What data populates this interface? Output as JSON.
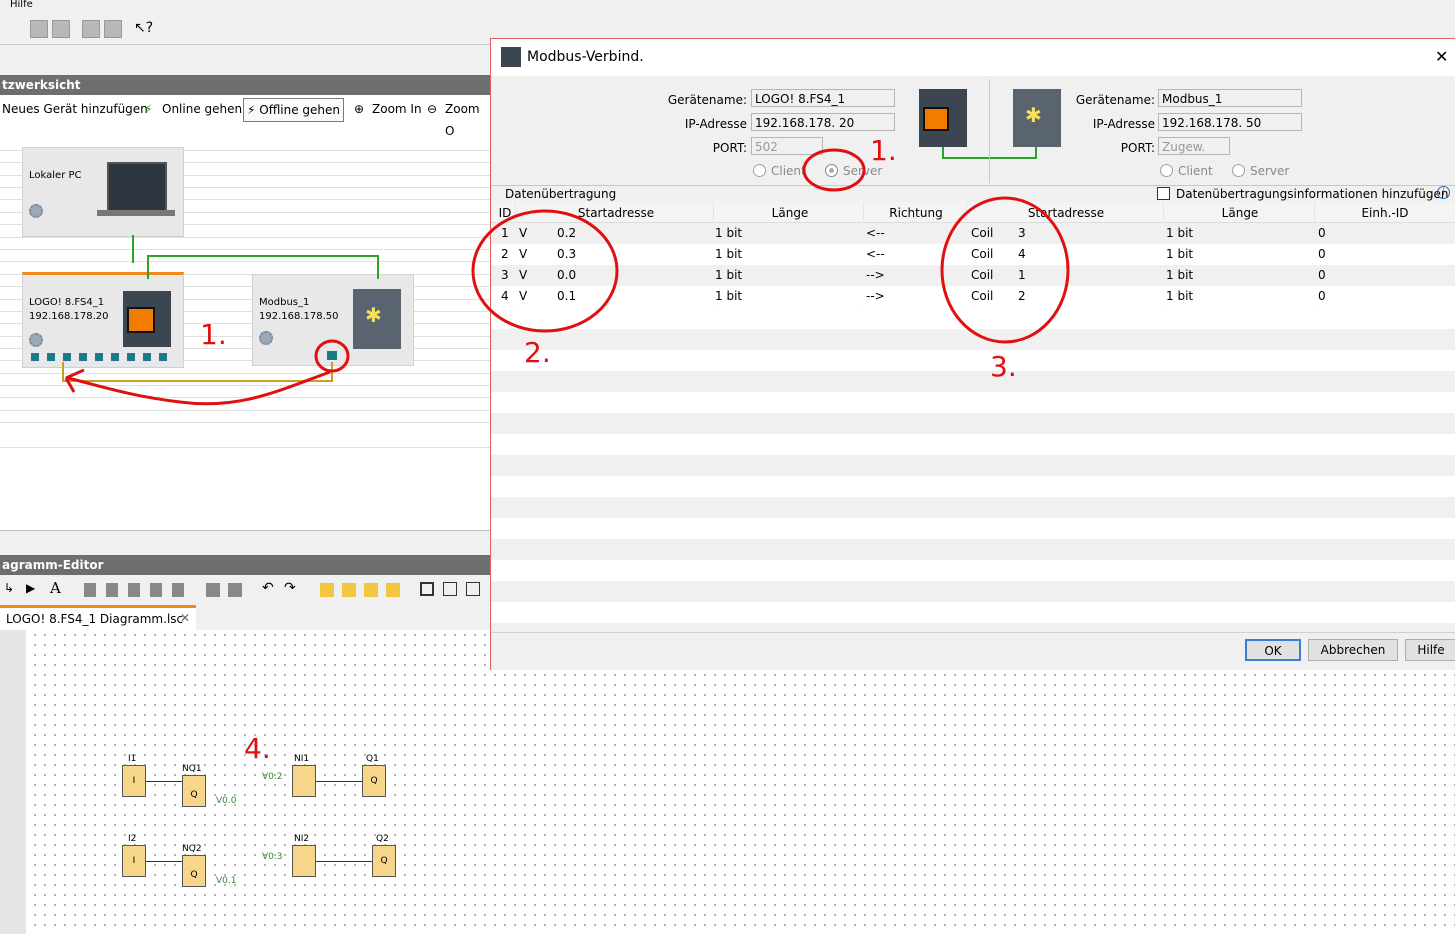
{
  "menu": {
    "help": "Hilfe"
  },
  "network_view": {
    "title": "tzwerksicht",
    "toolbar": {
      "add_device": "Neues Gerät hinzufügen",
      "online": "Online gehen",
      "offline": "Offline gehen",
      "zoom_in": "Zoom In",
      "zoom_out": "Zoom O"
    },
    "devices": {
      "pc": {
        "name": "Lokaler PC"
      },
      "logo": {
        "name": "LOGO! 8.FS4_1",
        "ip": "192.168.178.20"
      },
      "modbus": {
        "name": "Modbus_1",
        "ip": "192.168.178.50"
      }
    }
  },
  "diagram_editor": {
    "title": "agramm-Editor",
    "tab_label": "LOGO! 8.FS4_1 Diagramm.lsc",
    "toolbar_text_icon": "A"
  },
  "diagram": {
    "blocks": [
      {
        "top": "I1",
        "inner": "I"
      },
      {
        "top": "NQ1",
        "inner": "Q"
      },
      {
        "top": "NI1",
        "inner": ""
      },
      {
        "top": "Q1",
        "inner": "Q"
      },
      {
        "top": "I2",
        "inner": "I"
      },
      {
        "top": "NQ2",
        "inner": "Q"
      },
      {
        "top": "NI2",
        "inner": ""
      },
      {
        "top": "Q2",
        "inner": "Q"
      }
    ],
    "vlabels": [
      "V0.0",
      "V0.2",
      "V0.1",
      "V0.3"
    ]
  },
  "annotations": {
    "a1": "1.",
    "a1b": "1.",
    "a2": "2.",
    "a3": "3.",
    "a4": "4."
  },
  "dialog": {
    "title": "Modbus-Verbind.",
    "close": "✕",
    "left": {
      "device_name_label": "Gerätename:",
      "device_name": "LOGO! 8.FS4_1",
      "ip_label": "IP-Adresse",
      "ip": "192.168.178. 20",
      "port_label": "PORT:",
      "port": "502",
      "client": "Client",
      "server": "Server"
    },
    "right": {
      "device_name_label": "Gerätename:",
      "device_name": "Modbus_1",
      "ip_label": "IP-Adresse",
      "ip": "192.168.178. 50",
      "port_label": "PORT:",
      "port": "Zugew.",
      "client": "Client",
      "server": "Server"
    },
    "section_label": "Datenübertragung",
    "add_info_label": "Datenübertragungsinformationen hinzufügen",
    "info_icon": "i",
    "columns": [
      "ID",
      "Startadresse",
      "Länge",
      "Richtung",
      "Startadresse",
      "Länge",
      "Einh.-ID"
    ],
    "rows": [
      {
        "id": "1",
        "area": "V",
        "addr": "0.2",
        "len": "1 bit",
        "dir": "<--",
        "rarea": "Coil",
        "raddr": "3",
        "rlen": "1 bit",
        "unit": "0"
      },
      {
        "id": "2",
        "area": "V",
        "addr": "0.3",
        "len": "1 bit",
        "dir": "<--",
        "rarea": "Coil",
        "raddr": "4",
        "rlen": "1 bit",
        "unit": "0"
      },
      {
        "id": "3",
        "area": "V",
        "addr": "0.0",
        "len": "1 bit",
        "dir": "-->",
        "rarea": "Coil",
        "raddr": "1",
        "rlen": "1 bit",
        "unit": "0"
      },
      {
        "id": "4",
        "area": "V",
        "addr": "0.1",
        "len": "1 bit",
        "dir": "-->",
        "rarea": "Coil",
        "raddr": "2",
        "rlen": "1 bit",
        "unit": "0"
      }
    ],
    "buttons": {
      "ok": "OK",
      "cancel": "Abbrechen",
      "help": "Hilfe"
    }
  },
  "colors": {
    "annotation_red": "#e01010",
    "link_green": "#2aa52a",
    "block_fill": "#f7d58a",
    "logo_orange": "#f07c00"
  }
}
